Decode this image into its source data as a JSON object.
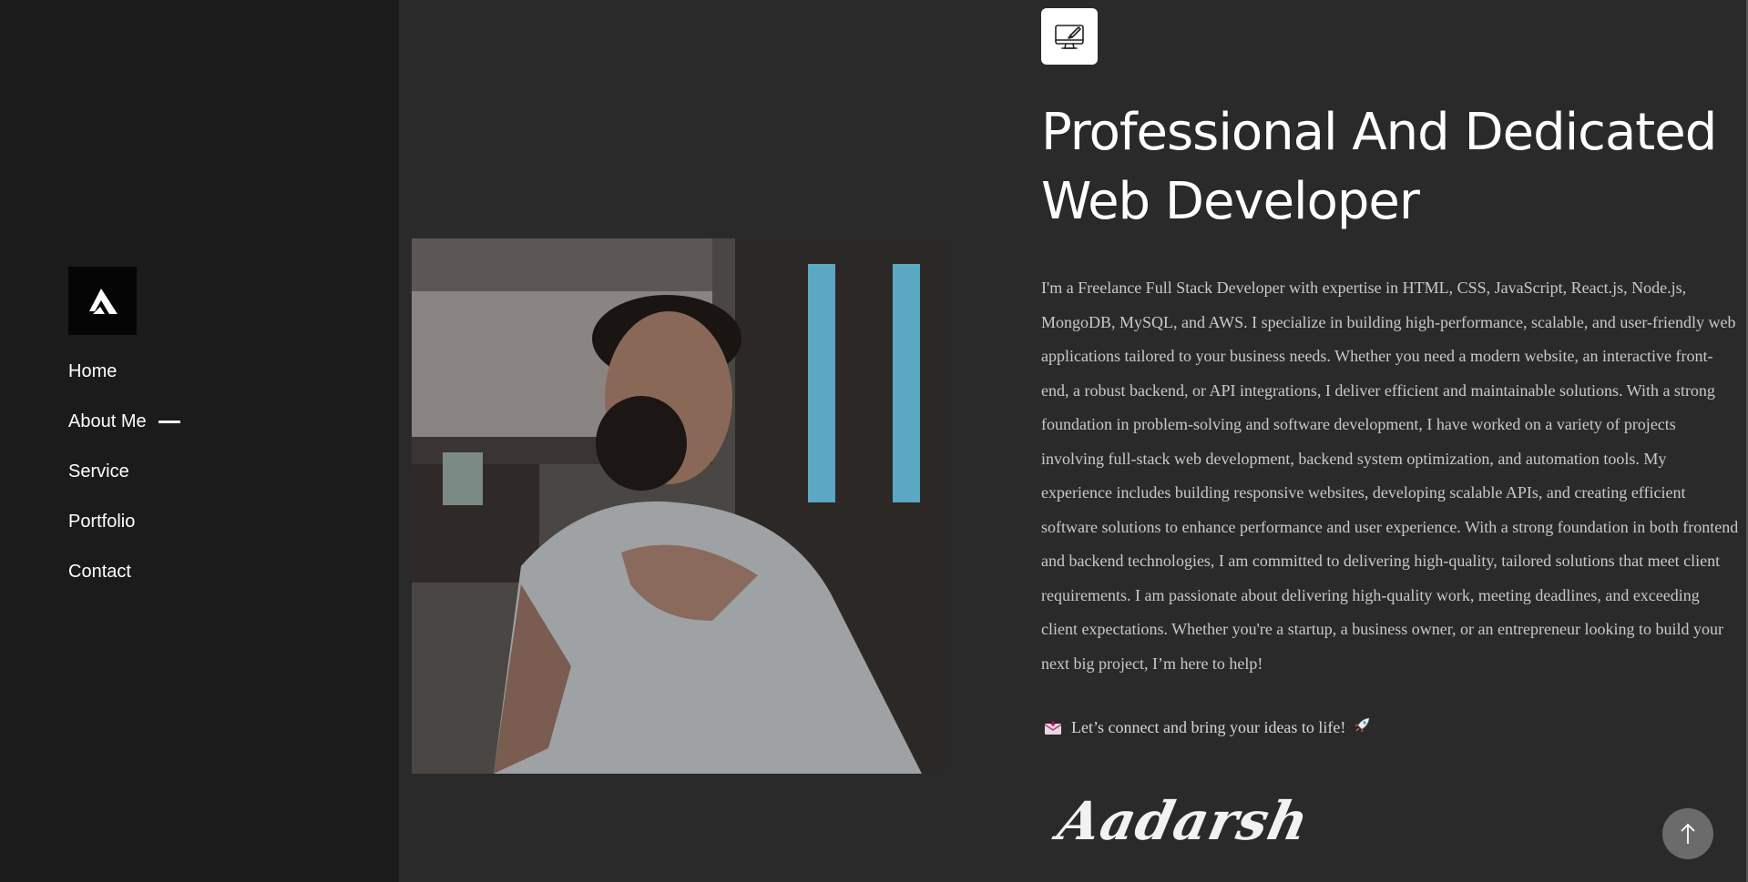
{
  "sidebar": {
    "logo_icon": "brand-logo-icon",
    "nav": [
      {
        "label": "Home",
        "active": false
      },
      {
        "label": "About Me",
        "active": true
      },
      {
        "label": "Service",
        "active": false
      },
      {
        "label": "Portfolio",
        "active": false
      },
      {
        "label": "Contact",
        "active": false
      }
    ]
  },
  "about": {
    "badge_icon": "monitor-design-icon",
    "headline_line1": "Professional And Dedicated",
    "headline_line2": "Web Developer",
    "bio": "I'm a Freelance Full Stack Developer with expertise in HTML, CSS, JavaScript, React.js, Node.js, MongoDB, MySQL, and AWS. I specialize in building high-performance, scalable, and user-friendly web applications tailored to your business needs. Whether you need a modern website, an interactive front-end, a robust backend, or API integrations, I deliver efficient and maintainable solutions. With a strong foundation in problem-solving and software development, I have worked on a variety of projects involving full-stack web development, backend system optimization, and automation tools. My experience includes building responsive websites, developing scalable APIs, and creating efficient software solutions to enhance performance and user experience. With a strong foundation in both frontend and backend technologies, I am committed to delivering high-quality, tailored solutions that meet client requirements. I am passionate about delivering high-quality work, meeting deadlines, and exceeding client expectations. Whether you're a startup, a business owner, or an entrepreneur looking to build your next big project, I’m here to help!",
    "cta": "Let’s connect and bring your ideas to life!",
    "signature": "Aadarsh"
  },
  "colors": {
    "page_bg": "#2a2a2a",
    "sidebar_bg": "#1b1b1b",
    "text": "#ffffff",
    "body_text": "#c9c9c9"
  },
  "scroll_top_icon": "arrow-up-icon"
}
